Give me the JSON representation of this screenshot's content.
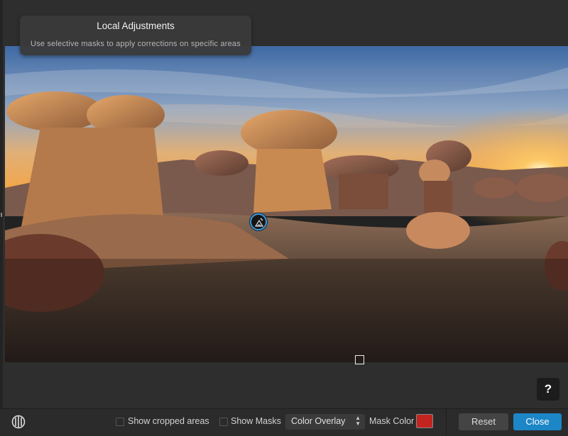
{
  "tooltip": {
    "title": "Local Adjustments",
    "subtitle": "Use selective masks to apply corrections on specific areas"
  },
  "canvas": {
    "image_subject": "hoodoo rock formations at sunset",
    "pin_icon": "brush-mask-icon"
  },
  "help": {
    "label": "?"
  },
  "bottombar": {
    "show_cropped_label": "Show cropped areas",
    "show_cropped_checked": false,
    "show_masks_label": "Show Masks",
    "show_masks_checked": false,
    "overlay_select": {
      "selected": "Color Overlay"
    },
    "mask_color_label": "Mask Color",
    "mask_color": "#c4241f",
    "reset_label": "Reset",
    "close_label": "Close"
  },
  "colors": {
    "accent": "#1d86c7",
    "background": "#2e2e2e"
  }
}
